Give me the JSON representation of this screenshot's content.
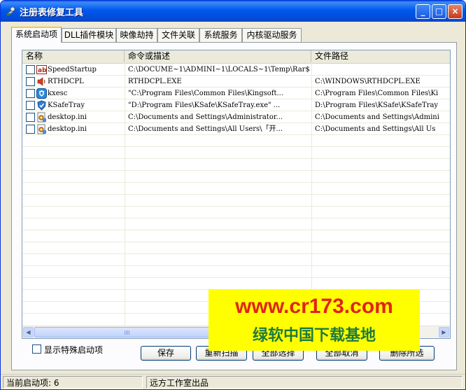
{
  "window": {
    "title": "注册表修复工具",
    "minimize": "_",
    "maximize": "□",
    "close": "×"
  },
  "tabs": [
    {
      "label": "系统启动项",
      "active": true
    },
    {
      "label": "DLL插件模块",
      "active": false
    },
    {
      "label": "映像劫持",
      "active": false
    },
    {
      "label": "文件关联",
      "active": false
    },
    {
      "label": "系统服务",
      "active": false
    },
    {
      "label": "内核驱动服务",
      "active": false
    }
  ],
  "list": {
    "columns": [
      "名称",
      "命令或描述",
      "文件路径"
    ],
    "rows": [
      {
        "checked": false,
        "icon": "ab-registry-icon",
        "name": "SpeedStartup",
        "command": "C:\\DOCUME~1\\ADMINI~1\\LOCALS~1\\Temp\\Rar$...",
        "path": ""
      },
      {
        "checked": false,
        "icon": "speaker-icon",
        "name": "RTHDCPL",
        "command": "RTHDCPL.EXE",
        "path": "C:\\WINDOWS\\RTHDCPL.EXE"
      },
      {
        "checked": false,
        "icon": "kingsoft-shield-icon",
        "name": "kxesc",
        "command": "\"C:\\Program Files\\Common Files\\Kingsoft...",
        "path": "C:\\Program Files\\Common Files\\Ki"
      },
      {
        "checked": false,
        "icon": "ksafe-shield-icon",
        "name": "KSafeTray",
        "command": "\"D:\\Program Files\\KSafe\\KSafeTray.exe\" ...",
        "path": "D:\\Program Files\\KSafe\\KSafeTray"
      },
      {
        "checked": false,
        "icon": "ini-settings-icon",
        "name": "desktop.ini",
        "command": "C:\\Documents and Settings\\Administrator...",
        "path": "C:\\Documents and Settings\\Admini"
      },
      {
        "checked": false,
        "icon": "ini-settings-icon",
        "name": "desktop.ini",
        "command": "C:\\Documents and Settings\\All Users\\「开...",
        "path": "C:\\Documents and Settings\\All Us"
      }
    ]
  },
  "options": {
    "show_special_label": "显示特殊启动项",
    "show_special_checked": false
  },
  "buttons": {
    "save": "保存",
    "rescan": "重新扫描",
    "select_all": "全部选择",
    "cancel_all": "全部取消",
    "delete_selected": "删除所选"
  },
  "watermark": {
    "url": "www.cr173.com",
    "text": "绿软中国下载基地"
  },
  "status": {
    "count_label": "当前启动项:",
    "count": "6",
    "author": "远方工作室出品"
  },
  "colors": {
    "titlebar": "#0058ee",
    "watermark_bg": "#ffff00",
    "watermark_url": "#e02418",
    "watermark_text": "#1f7a3c",
    "active_tab_accent": "#ffc83c"
  }
}
